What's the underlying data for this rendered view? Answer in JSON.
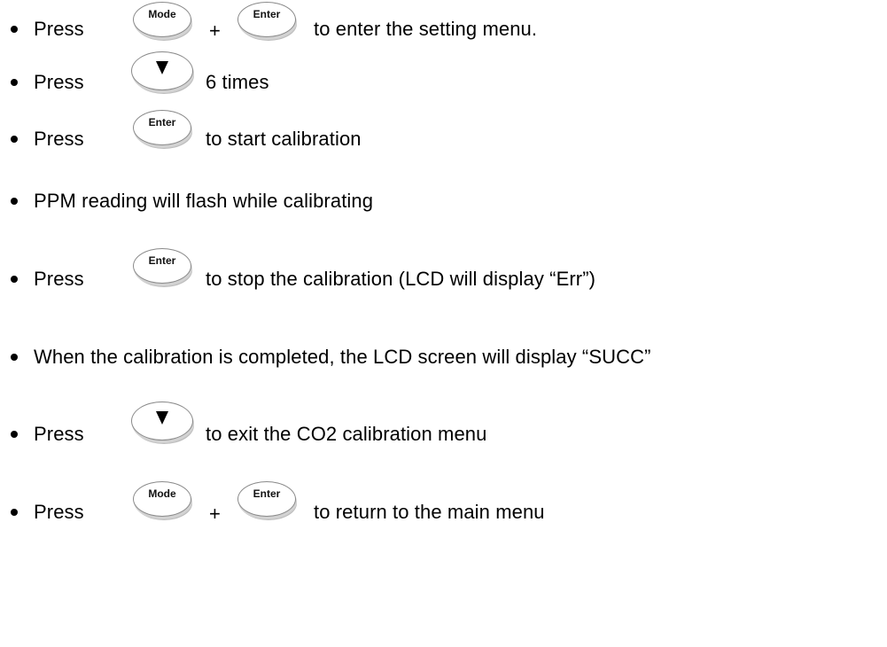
{
  "keys": {
    "mode": "Mode",
    "enter": "Enter",
    "down_arrow_icon": "down-triangle-icon"
  },
  "steps": [
    {
      "before": "Press",
      "plus": "+",
      "after": "to enter the setting menu."
    },
    {
      "before": "Press",
      "after": "6 times"
    },
    {
      "before": "Press",
      "after": "to start calibration"
    },
    {
      "text": "PPM reading will flash while calibrating"
    },
    {
      "before": "Press",
      "after": "to stop the calibration (LCD will display “Err”)"
    },
    {
      "text": "When the calibration is completed, the LCD screen will display “SUCC”"
    },
    {
      "before": "Press",
      "after": "to exit the CO2 calibration menu"
    },
    {
      "before": "Press",
      "plus": "+",
      "after": "to return to the main menu"
    }
  ]
}
